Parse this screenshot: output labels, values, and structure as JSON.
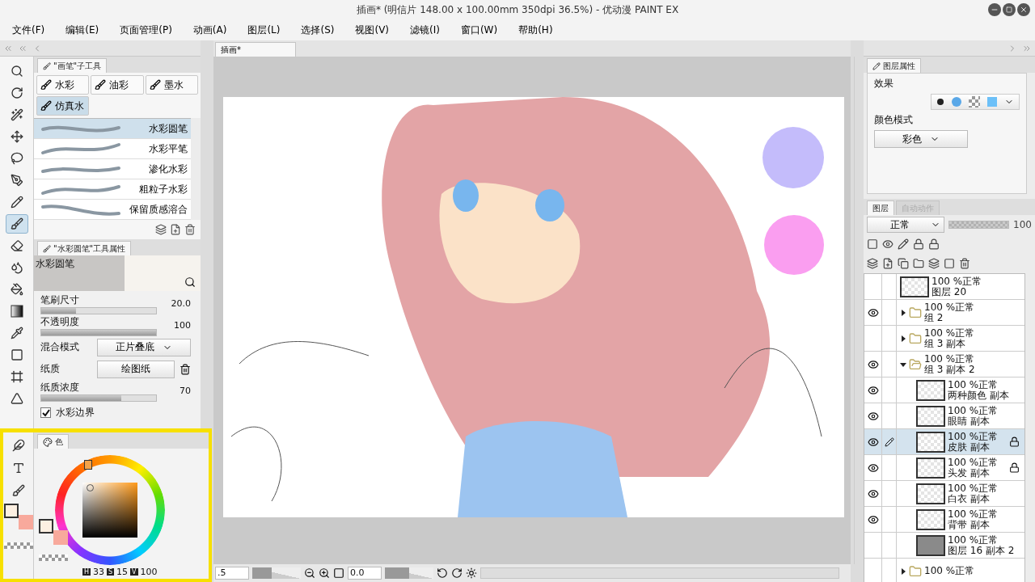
{
  "window": {
    "title": "插画* (明信片 148.00 x 100.00mm 350dpi 36.5%) - 优动漫 PAINT EX"
  },
  "menu": [
    "文件(F)",
    "编辑(E)",
    "页面管理(P)",
    "动画(A)",
    "图层(L)",
    "选择(S)",
    "视图(V)",
    "滤镜(I)",
    "窗口(W)",
    "帮助(H)"
  ],
  "document_tab": {
    "label": "插画*"
  },
  "tools": [
    {
      "kind": "zoom",
      "selected": false
    },
    {
      "kind": "rotate",
      "selected": false
    },
    {
      "kind": "wand",
      "selected": false
    },
    {
      "kind": "move",
      "selected": false
    },
    {
      "kind": "lasso",
      "selected": false
    },
    {
      "kind": "pen",
      "selected": false
    },
    {
      "kind": "pencil",
      "selected": false
    },
    {
      "kind": "brush",
      "selected": true
    },
    {
      "kind": "eraser",
      "selected": false
    },
    {
      "kind": "drops",
      "selected": false
    },
    {
      "kind": "bucket",
      "selected": false
    },
    {
      "kind": "gradient",
      "selected": false
    },
    {
      "kind": "dropper",
      "selected": false
    },
    {
      "kind": "rectangle",
      "selected": false
    },
    {
      "kind": "frame",
      "selected": false
    },
    {
      "kind": "ruler",
      "selected": false
    }
  ],
  "tools_lower": [
    {
      "kind": "feather",
      "selected": false
    },
    {
      "kind": "text",
      "selected": false
    },
    {
      "kind": "smudge",
      "selected": false
    }
  ],
  "tool_swatches": [
    {
      "color": "#fdf0e2",
      "selected": true
    },
    {
      "color": "#f8a99c",
      "selected": false
    }
  ],
  "subtool_panel": {
    "title": "\"画笔\"子工具",
    "groups": [
      {
        "label": "水彩",
        "selected": false
      },
      {
        "label": "油彩",
        "selected": false
      },
      {
        "label": "墨水",
        "selected": false
      },
      {
        "label": "仿真水",
        "selected": true
      }
    ],
    "brushes": [
      {
        "name": "水彩圆笔",
        "selected": true
      },
      {
        "name": "水彩平笔",
        "selected": false
      },
      {
        "name": "渗化水彩",
        "selected": false
      },
      {
        "name": "粗粒子水彩",
        "selected": false
      },
      {
        "name": "保留质感溶合",
        "selected": false
      }
    ]
  },
  "tool_property": {
    "title": "\"水彩圆笔\"工具属性",
    "preview_label": "水彩圆笔",
    "rows": [
      {
        "kind": "slider",
        "label": "笔刷尺寸",
        "value": "20.0",
        "level": 0.3
      },
      {
        "kind": "slider",
        "label": "不透明度",
        "value": "100",
        "level": 1
      },
      {
        "kind": "select",
        "label": "混合模式",
        "value": "正片叠底"
      },
      {
        "kind": "button",
        "label": "纸质",
        "value": "绘图纸"
      },
      {
        "kind": "slider",
        "label": "纸质浓度",
        "value": "70",
        "level": 0.7
      },
      {
        "kind": "checkbox",
        "label": "水彩边界",
        "checked": true
      }
    ]
  },
  "color_panel": {
    "tab": "色",
    "swatches": [
      {
        "color": "#fdf0e2",
        "selected": true
      },
      {
        "color": "#f8a99c",
        "selected": false
      }
    ],
    "readout": [
      {
        "label": "H",
        "value": "33"
      },
      {
        "label": "S",
        "value": "15"
      },
      {
        "label": "V",
        "value": "100"
      }
    ]
  },
  "navigator": {
    "zoom": ".5",
    "zoom_slider": {
      "level": 0.4
    },
    "angle": "0.0",
    "rotation_slider": {
      "level": 0.5
    }
  },
  "layer_property": {
    "title": "图层属性",
    "effect_label": "效果",
    "color_mode_label": "颜色模式",
    "color_mode": "彩色"
  },
  "layers_panel": {
    "tabs": [
      {
        "label": "图层",
        "selected": true
      },
      {
        "label": "自动动作",
        "selected": false
      }
    ],
    "blend_mode": "正常",
    "opacity_slider": {
      "level": 1
    },
    "opacity": "100",
    "layers": [
      {
        "kind": "layer",
        "info": "100 %正常",
        "name": "图层 20",
        "visible": false,
        "editing": false,
        "locked": false,
        "selected": false,
        "filled": false
      },
      {
        "kind": "folder",
        "info": "100 %正常",
        "name": "组 2",
        "visible": true,
        "editing": false,
        "locked": false,
        "selected": false,
        "expanded": false
      },
      {
        "kind": "folder",
        "info": "100 %正常",
        "name": "组 3 副本",
        "visible": false,
        "editing": false,
        "locked": false,
        "selected": false,
        "expanded": false
      },
      {
        "kind": "folder",
        "info": "100 %正常",
        "name": "组 3 副本 2",
        "visible": true,
        "editing": false,
        "locked": false,
        "selected": false,
        "expanded": true,
        "children": [
          {
            "kind": "layer",
            "info": "100 %正常",
            "name": "两种颜色 副本",
            "visible": true,
            "editing": false,
            "locked": false,
            "selected": false,
            "filled": false
          },
          {
            "kind": "layer",
            "info": "100 %正常",
            "name": "眼睛 副本",
            "visible": true,
            "editing": false,
            "locked": false,
            "selected": false,
            "filled": false
          },
          {
            "kind": "layer",
            "info": "100 %正常",
            "name": "皮肤 副本",
            "visible": true,
            "editing": true,
            "locked": true,
            "selected": true,
            "filled": false
          },
          {
            "kind": "layer",
            "info": "100 %正常",
            "name": "头发 副本",
            "visible": true,
            "editing": false,
            "locked": true,
            "selected": false,
            "filled": false
          },
          {
            "kind": "layer",
            "info": "100 %正常",
            "name": "白衣 副本",
            "visible": true,
            "editing": false,
            "locked": false,
            "selected": false,
            "filled": false
          },
          {
            "kind": "layer",
            "info": "100 %正常",
            "name": "背带 副本",
            "visible": true,
            "editing": false,
            "locked": false,
            "selected": false,
            "filled": false
          },
          {
            "kind": "layer",
            "info": "100 %正常",
            "name": "图层 16 副本 2",
            "visible": false,
            "editing": false,
            "locked": false,
            "selected": false,
            "filled": true
          }
        ]
      },
      {
        "kind": "folder",
        "info": "100 %正常",
        "visible": false,
        "editing": false,
        "locked": false,
        "selected": false,
        "expanded": false
      }
    ]
  }
}
